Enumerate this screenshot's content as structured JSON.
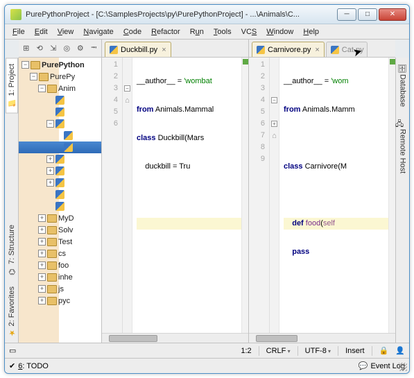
{
  "window": {
    "title": "PurePythonProject - [C:\\SamplesProjects\\py\\PurePythonProject] - ...\\Animals\\C..."
  },
  "menu": {
    "file": "File",
    "edit": "Edit",
    "view": "View",
    "navigate": "Navigate",
    "code": "Code",
    "refactor": "Refactor",
    "run": "Run",
    "tools": "Tools",
    "vcs": "VCS",
    "window": "Window",
    "help": "Help"
  },
  "side_left": {
    "project": "1: Project",
    "structure": "7: Structure",
    "favorites": "2: Favorites"
  },
  "side_right": {
    "database": "Database",
    "remote": "Remote Host"
  },
  "tree": {
    "root": "PurePython",
    "lvl1": "PurePy",
    "lvl2": "Anim",
    "folders": [
      "MyD",
      "Solv",
      "Test",
      "cs",
      "foo",
      "inhe",
      "js",
      "pyc"
    ]
  },
  "editor_left": {
    "tab": "Duckbill.py",
    "lines": {
      "l1_a": "__author__ = ",
      "l1_b": "'wombat",
      "l2_a": "from",
      "l2_b": " Animals.Mammal",
      "l3_a": "class",
      "l3_b": " Duckbill(Mars",
      "l4_a": "    duckbill = Tru"
    }
  },
  "editor_right": {
    "tab": "Carnivore.py",
    "bg_tab": "Cat.py",
    "lines": {
      "l1_a": "__author__ = ",
      "l1_b": "'wom",
      "l2_a": "from",
      "l2_b": " Animals.Mamm",
      "l4_a": "class",
      "l4_b": " Carnivore(M",
      "l6_a": "    def ",
      "l6_b": "food",
      "l6_c": "(",
      "l6_d": "self",
      "l7_a": "    pass"
    }
  },
  "status": {
    "pos": "1:2",
    "eol": "CRLF",
    "enc": "UTF-8",
    "mode": "Insert"
  },
  "bottom": {
    "todo": "6: TODO",
    "eventlog": "Event Log"
  }
}
